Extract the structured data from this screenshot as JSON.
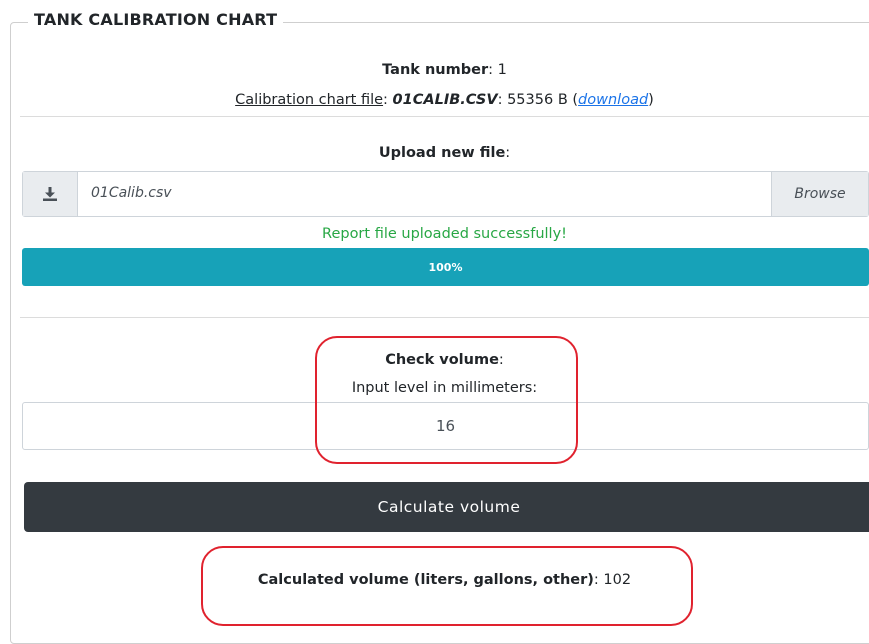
{
  "fieldset": {
    "legend": "TANK CALIBRATION CHART"
  },
  "tank": {
    "label": "Tank number",
    "sep": ": ",
    "value": "1"
  },
  "calibration": {
    "label": "Calibration chart file",
    "sep1": ": ",
    "filename": "01CALIB.CSV",
    "sep2": ": ",
    "size": "55356 B",
    "open_paren": " (",
    "download_label": "download",
    "close_paren": ")"
  },
  "upload": {
    "label": "Upload new file",
    "colon": ":",
    "file_value": "01Calib.csv",
    "browse_label": "Browse",
    "icon": "download-icon"
  },
  "status": {
    "message": "Report file uploaded successfully!",
    "progress_label": "100%",
    "progress_value": 100
  },
  "check": {
    "title": "Check volume",
    "colon": ":",
    "instruction": "Input level in millimeters:",
    "level_value": "16"
  },
  "calculate": {
    "button_label": "Calculate volume"
  },
  "result": {
    "label": "Calculated volume (liters, gallons, other)",
    "sep": ": ",
    "value": "102"
  },
  "colors": {
    "accent_progress": "#17a2b8",
    "success": "#28a745",
    "dark_button": "#343a40",
    "highlight": "#e0222e",
    "link": "#1a73e8"
  }
}
